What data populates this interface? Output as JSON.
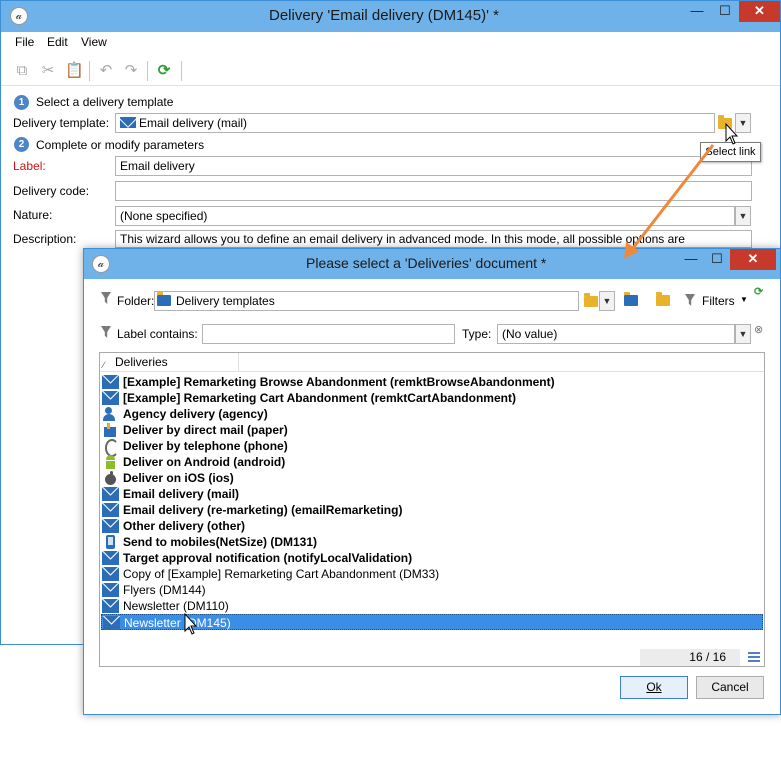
{
  "main_window": {
    "title": "Delivery 'Email delivery (DM145)' *",
    "controls": {
      "minimize": "—",
      "maximize": "☐",
      "close": "✕"
    },
    "menu": [
      "File",
      "Edit",
      "View"
    ],
    "toolbar_icons": [
      "copy-icon",
      "cut-icon",
      "paste-icon",
      "undo-icon",
      "redo-icon",
      "refresh-icon"
    ],
    "step1": {
      "num": "1",
      "title": "Select a delivery template"
    },
    "delivery_template": {
      "label": "Delivery template:",
      "value": "Email delivery (mail)"
    },
    "step2": {
      "num": "2",
      "title": "Complete or modify parameters"
    },
    "label_field": {
      "label": "Label:",
      "value": "Email delivery"
    },
    "delivery_code": {
      "label": "Delivery code:",
      "value": ""
    },
    "nature": {
      "label": "Nature:",
      "value": "(None specified)"
    },
    "description": {
      "label": "Description:",
      "value": "This wizard allows you to define an email delivery in advanced mode. In this mode, all possible options are"
    },
    "tooltip": "Select link"
  },
  "dialog": {
    "title": "Please select a 'Deliveries' document *",
    "controls": {
      "minimize": "—",
      "maximize": "☐",
      "close": "✕"
    },
    "folder": {
      "label": "Folder:",
      "value": "Delivery templates"
    },
    "filters_label": "Filters",
    "label_contains": {
      "label": "Label contains:",
      "value": ""
    },
    "type": {
      "label": "Type:",
      "value": "(No value)"
    },
    "list": {
      "column": "Deliveries",
      "items": [
        {
          "text": "[Example] Remarketing Browse Abandonment (remktBrowseAbandonment)",
          "bold": true,
          "icon": "mail"
        },
        {
          "text": "[Example] Remarketing Cart Abandonment (remktCartAbandonment)",
          "bold": true,
          "icon": "mail"
        },
        {
          "text": "Agency delivery (agency)",
          "bold": true,
          "icon": "agency"
        },
        {
          "text": "Deliver by direct mail (paper)",
          "bold": true,
          "icon": "dm"
        },
        {
          "text": "Deliver by telephone (phone)",
          "bold": true,
          "icon": "phone"
        },
        {
          "text": "Deliver on Android (android)",
          "bold": true,
          "icon": "android"
        },
        {
          "text": "Deliver on iOS (ios)",
          "bold": true,
          "icon": "ios"
        },
        {
          "text": "Email delivery (mail)",
          "bold": true,
          "icon": "mail"
        },
        {
          "text": "Email delivery (re-marketing) (emailRemarketing)",
          "bold": true,
          "icon": "mail"
        },
        {
          "text": "Other delivery (other)",
          "bold": true,
          "icon": "mail"
        },
        {
          "text": "Send to mobiles(NetSize) (DM131)",
          "bold": true,
          "icon": "mobile"
        },
        {
          "text": "Target approval notification (notifyLocalValidation)",
          "bold": true,
          "icon": "mail"
        },
        {
          "text": "Copy of [Example] Remarketing Cart Abandonment (DM33)",
          "bold": false,
          "icon": "mail"
        },
        {
          "text": "Flyers (DM144)",
          "bold": false,
          "icon": "mail"
        },
        {
          "text": "Newsletter (DM110)",
          "bold": false,
          "icon": "mail"
        },
        {
          "text": "Newsletter (DM145)",
          "bold": false,
          "icon": "mail",
          "selected": true
        }
      ]
    },
    "count": "16 / 16",
    "ok_label": "Ok",
    "cancel_label": "Cancel"
  },
  "colors": {
    "titlebar": "#6fb2ea",
    "selection": "#3a8ee6",
    "arrow": "#f0883a",
    "required_label": "#c8161d"
  }
}
